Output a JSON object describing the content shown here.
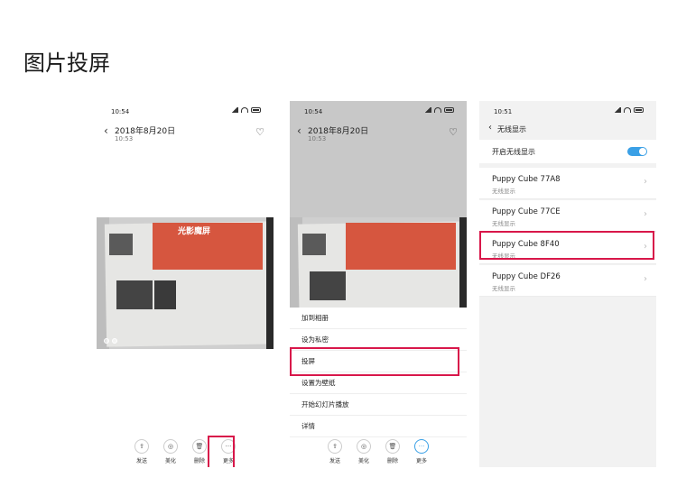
{
  "page_title": "图片投屏",
  "phone1": {
    "status_time": "10:54",
    "date": "2018年8月20日",
    "time": "10:53",
    "photo_title": "光影魔屏",
    "toolbar": [
      {
        "icon": "share-icon",
        "glyph": "⇪",
        "label": "发送"
      },
      {
        "icon": "beautify-icon",
        "glyph": "◎",
        "label": "美化"
      },
      {
        "icon": "delete-icon",
        "glyph": "🗑",
        "label": "删除"
      },
      {
        "icon": "more-icon",
        "glyph": "···",
        "label": "更多"
      }
    ]
  },
  "phone2": {
    "status_time": "10:54",
    "date": "2018年8月20日",
    "time": "10:53",
    "menu": [
      "加到相册",
      "设为私密",
      "投屏",
      "设置为壁纸",
      "开始幻灯片播放",
      "详情"
    ],
    "toolbar": [
      {
        "icon": "share-icon",
        "glyph": "⇪",
        "label": "发送"
      },
      {
        "icon": "beautify-icon",
        "glyph": "◎",
        "label": "美化"
      },
      {
        "icon": "delete-icon",
        "glyph": "🗑",
        "label": "删除"
      },
      {
        "icon": "more-icon",
        "glyph": "···",
        "label": "更多"
      }
    ]
  },
  "phone3": {
    "status_time": "10:51",
    "nav_title": "无线显示",
    "toggle_label": "开启无线显示",
    "devices": [
      {
        "name": "Puppy Cube 77A8",
        "sub": "无线显示"
      },
      {
        "name": "Puppy Cube 77CE",
        "sub": "无线显示"
      },
      {
        "name": "Puppy Cube 8F40",
        "sub": "无线显示"
      },
      {
        "name": "Puppy Cube DF26",
        "sub": "无线显示"
      }
    ]
  },
  "colors": {
    "highlight": "#d8174a",
    "accent": "#3aa0e6",
    "photo_orange": "#d6563f"
  }
}
